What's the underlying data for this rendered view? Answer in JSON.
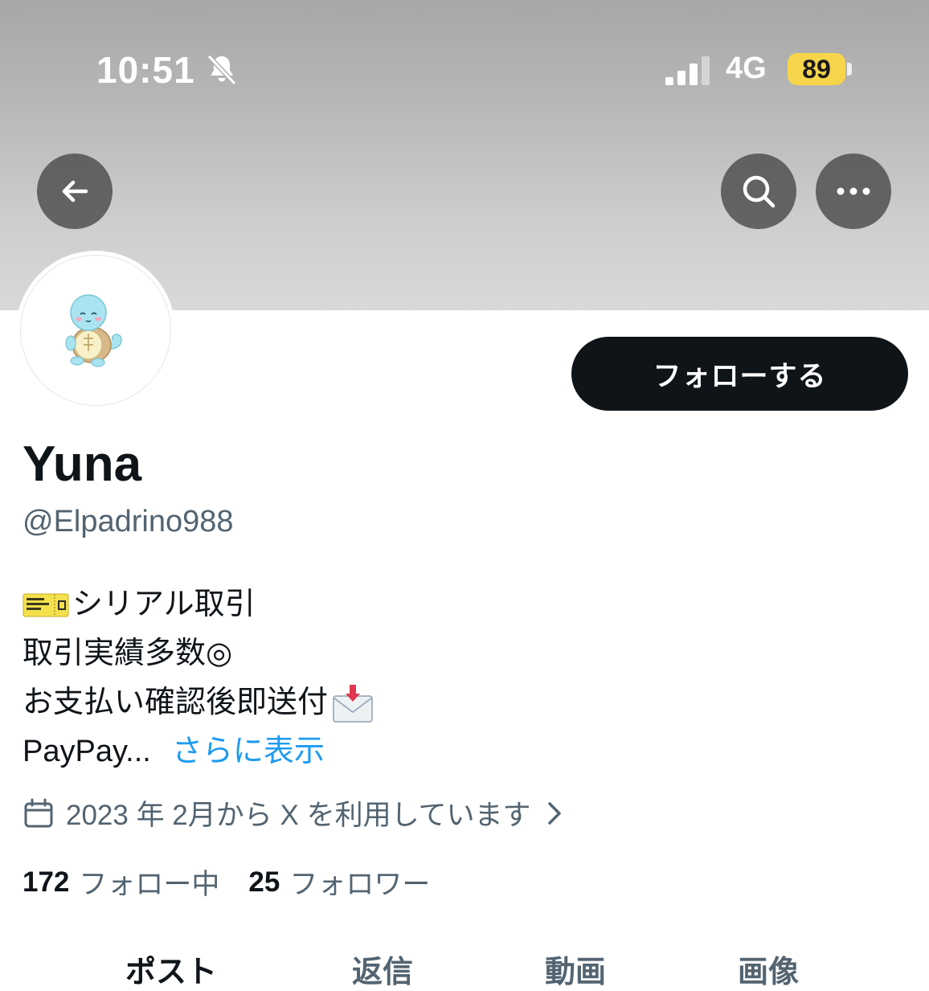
{
  "status_bar": {
    "time": "10:51",
    "network": "4G",
    "battery": "89"
  },
  "colors": {
    "accent": "#1d9bf0",
    "follow_bg": "#0f1419",
    "battery": "#f7d54a",
    "muted_text": "#536471"
  },
  "nav": {
    "back_icon": "arrow-left-icon",
    "search_icon": "search-icon",
    "more_icon": "more-horizontal-icon"
  },
  "profile": {
    "follow_label": "フォローする",
    "name": "Yuna",
    "handle": "@Elpadrino988",
    "bio": {
      "line1": "シリアル取引",
      "line2": "取引実績多数◎",
      "line3": "お支払い確認後即送付",
      "line4": "PayPay...",
      "more_label": "さらに表示"
    },
    "joined": "2023 年 2月から X を利用しています",
    "following_count": "172",
    "following_label": "フォロー中",
    "followers_count": "25",
    "followers_label": "フォロワー"
  },
  "tabs": [
    {
      "label": "ポスト"
    },
    {
      "label": "返信"
    },
    {
      "label": "動画"
    },
    {
      "label": "画像"
    }
  ]
}
